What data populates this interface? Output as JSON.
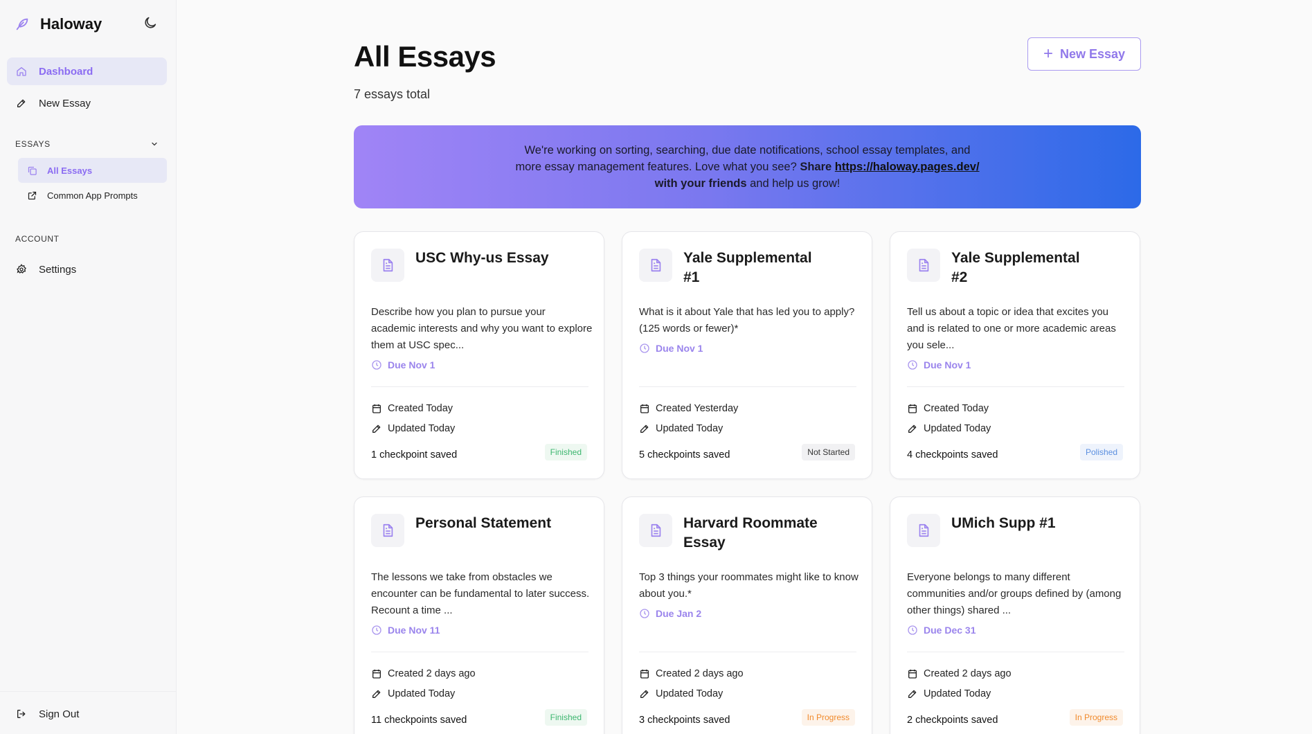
{
  "app": {
    "name": "Haloway"
  },
  "sidebar": {
    "dashboard_label": "Dashboard",
    "new_essay_label": "New Essay",
    "essays_section_label": "ESSAYS",
    "all_essays_label": "All Essays",
    "common_app_label": "Common App Prompts",
    "account_section_label": "ACCOUNT",
    "settings_label": "Settings",
    "sign_out_label": "Sign Out"
  },
  "main": {
    "title": "All Essays",
    "subtitle": "7 essays total",
    "new_essay_button": "New Essay",
    "banner": {
      "text_1": "We're working on sorting, searching, due date notifications, school essay templates, and more essay management features. Love what you see? ",
      "share": "Share",
      "link": "https://haloway.pages.dev/",
      "friends": " with your friends",
      "text_2": " and help us grow!"
    }
  },
  "cards": [
    {
      "title": "USC Why-us Essay",
      "desc": "Describe how you plan to pursue your academic interests and why you want to explore them at USC spec...",
      "due": "Due Nov 1",
      "created": "Created Today",
      "updated": "Updated Today",
      "checkpoints": "1 checkpoint saved",
      "status": "Finished"
    },
    {
      "title": "Yale Supplemental #1",
      "desc": "What is it about Yale that has led you to apply? (125 words or fewer)*",
      "due": "Due Nov 1",
      "created": "Created Yesterday",
      "updated": "Updated Today",
      "checkpoints": "5 checkpoints saved",
      "status": "Not Started"
    },
    {
      "title": "Yale Supplemental #2",
      "desc": "Tell us about a topic or idea that excites you and is related to one or more academic areas you sele...",
      "due": "Due Nov 1",
      "created": "Created Today",
      "updated": "Updated Today",
      "checkpoints": "4 checkpoints saved",
      "status": "Polished"
    },
    {
      "title": "Personal Statement",
      "desc": "The lessons we take from obstacles we encounter can be fundamental to later success. Recount a time ...",
      "due": "Due Nov 11",
      "created": "Created 2 days ago",
      "updated": "Updated Today",
      "checkpoints": "11 checkpoints saved",
      "status": "Finished"
    },
    {
      "title": "Harvard Roommate Essay",
      "desc": "Top 3 things your roommates might like to know about you.*",
      "due": "Due Jan 2",
      "created": "Created 2 days ago",
      "updated": "Updated Today",
      "checkpoints": "3 checkpoints saved",
      "status": "In Progress"
    },
    {
      "title": "UMich Supp #1",
      "desc": "Everyone belongs to many different communities and/or groups defined by (among other things) shared ...",
      "due": "Due Dec 31",
      "created": "Created 2 days ago",
      "updated": "Updated Today",
      "checkpoints": "2 checkpoints saved",
      "status": "In Progress"
    }
  ],
  "colors": {
    "accent": "#8b6cf2",
    "finished": "#3cb66f",
    "polished": "#5b8fe0",
    "in_progress": "#f08a2c"
  },
  "icons": [
    "feather-logo-icon",
    "moon-icon",
    "home-icon",
    "pencil-icon",
    "chevron-down-icon",
    "copy-icon",
    "external-link-icon",
    "gear-icon",
    "sign-out-icon",
    "plus-icon",
    "document-icon",
    "clock-icon",
    "calendar-icon"
  ]
}
